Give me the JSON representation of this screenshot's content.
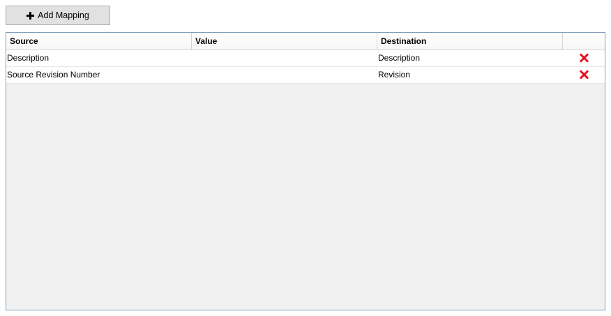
{
  "toolbar": {
    "add_mapping_label": "Add Mapping",
    "add_icon": "plus-icon"
  },
  "grid": {
    "columns": [
      "Source",
      "Value",
      "Destination",
      ""
    ],
    "rows": [
      {
        "source": "Description",
        "value": "",
        "destination": "Description",
        "action_icon": "delete-icon"
      },
      {
        "source": "Source Revision Number",
        "value": "",
        "destination": "Revision",
        "action_icon": "delete-icon"
      }
    ]
  },
  "colors": {
    "delete": "#e81123",
    "grid_border": "#7f9db9",
    "grid_background": "#f0f0f0"
  }
}
